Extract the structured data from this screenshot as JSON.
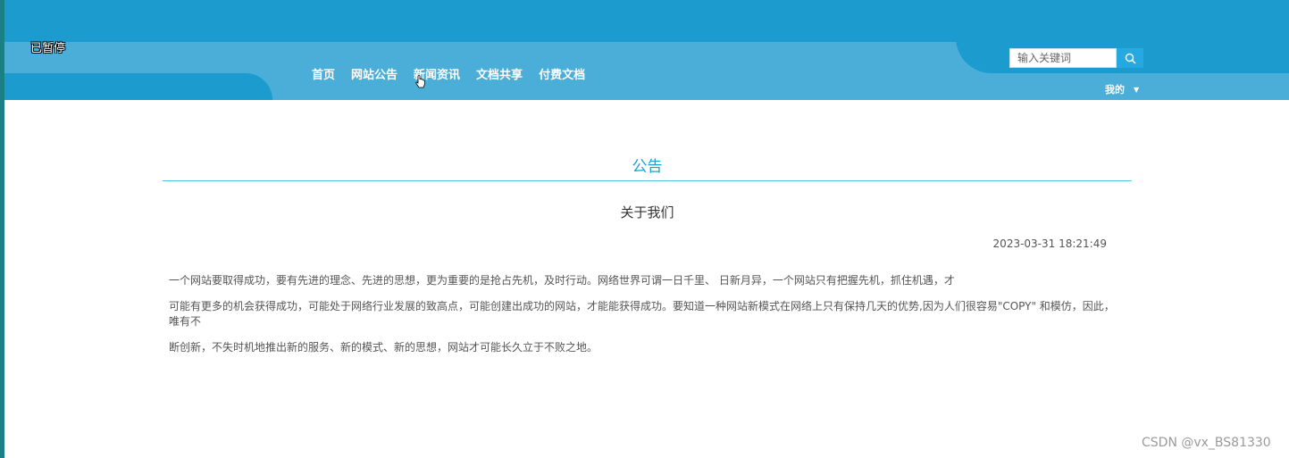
{
  "overlay": {
    "paused_label": "已暂停"
  },
  "nav": {
    "items": [
      "首页",
      "网站公告",
      "新闻资讯",
      "文档共享",
      "付费文档"
    ]
  },
  "search": {
    "placeholder": "输入关键词",
    "icon": "search-icon"
  },
  "user_menu": {
    "label": "我的",
    "icon": "caret-down-icon"
  },
  "notice": {
    "section_title": "公告",
    "title": "关于我们",
    "date": "2023-03-31 18:21:49",
    "paragraphs": [
      "一个网站要取得成功，要有先进的理念、先进的思想，更为重要的是抢占先机，及时行动。网络世界可谓一日千里、 日新月异，一个网站只有把握先机，抓住机遇，才",
      "可能有更多的机会获得成功，可能处于网络行业发展的致高点，可能创建出成功的网站，才能能获得成功。要知道一种网站新模式在网络上只有保持几天的优势,因为人们很容易\"COPY\" 和模仿，因此，唯有不",
      "断创新，不失时机地推出新的服务、新的模式、新的思想，网站才可能长久立于不败之地。"
    ]
  },
  "watermark": "CSDN @vx_BS81330",
  "colors": {
    "header": "#1b9bce",
    "band": "#4aaed9",
    "accent": "#1aa2d0"
  }
}
